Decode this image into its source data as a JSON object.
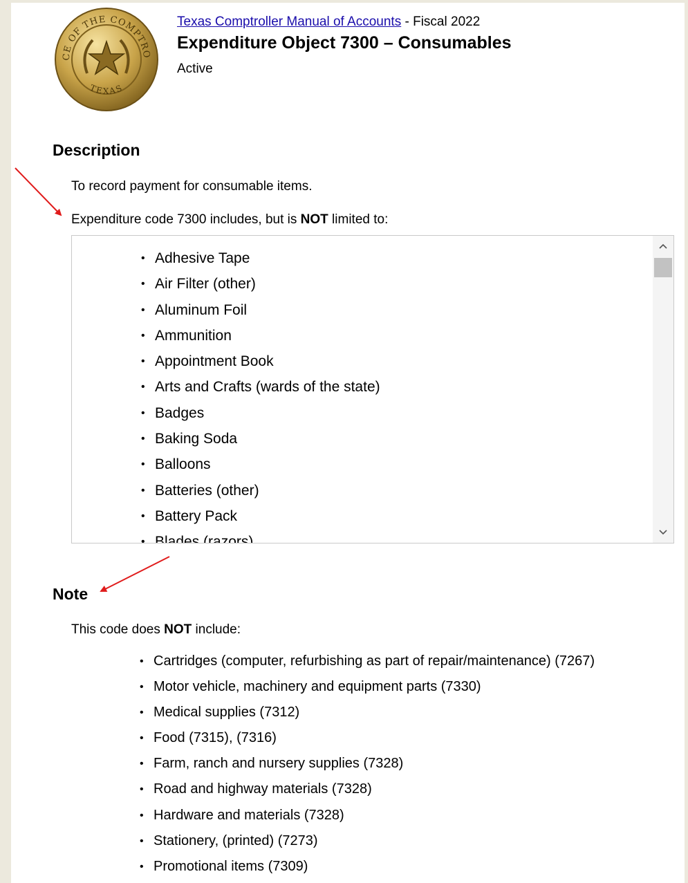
{
  "header": {
    "manual_link": "Texas Comptroller Manual of Accounts",
    "fiscal_suffix": " - Fiscal 2022",
    "title": "Expenditure Object 7300 – Consumables",
    "status": "Active"
  },
  "seal": {
    "top_text": "OFFICE OF THE COMPTROLLER",
    "bottom_text": "TEXAS"
  },
  "description": {
    "heading": "Description",
    "line1": "To record payment for consumable items.",
    "line2_prefix": "Expenditure code 7300 includes, but is ",
    "line2_bold": "NOT",
    "line2_suffix": " limited to:",
    "items": [
      "Adhesive Tape",
      "Air Filter (other)",
      "Aluminum Foil",
      "Ammunition",
      "Appointment Book",
      "Arts and Crafts (wards of the state)",
      "Badges",
      "Baking Soda",
      "Balloons",
      "Batteries (other)",
      "Battery Pack",
      "Blades (razors)"
    ]
  },
  "note": {
    "heading": "Note",
    "intro_prefix": "This code does ",
    "intro_bold": "NOT",
    "intro_suffix": " include:",
    "items": [
      "Cartridges (computer, refurbishing as part of repair/maintenance) (7267)",
      "Motor vehicle, machinery and equipment parts (7330)",
      "Medical supplies (7312)",
      "Food (7315), (7316)",
      "Farm, ranch and nursery supplies (7328)",
      "Road and highway materials (7328)",
      "Hardware and materials (7328)",
      "Stationery, (printed) (7273)",
      "Promotional items (7309)"
    ]
  },
  "colors": {
    "link": "#1a0dab",
    "annotation_arrow": "#e01b1b",
    "page_bg": "#ece9dd"
  },
  "icons": {
    "scroll_up": "chevron-up-icon",
    "scroll_down": "chevron-down-icon"
  }
}
